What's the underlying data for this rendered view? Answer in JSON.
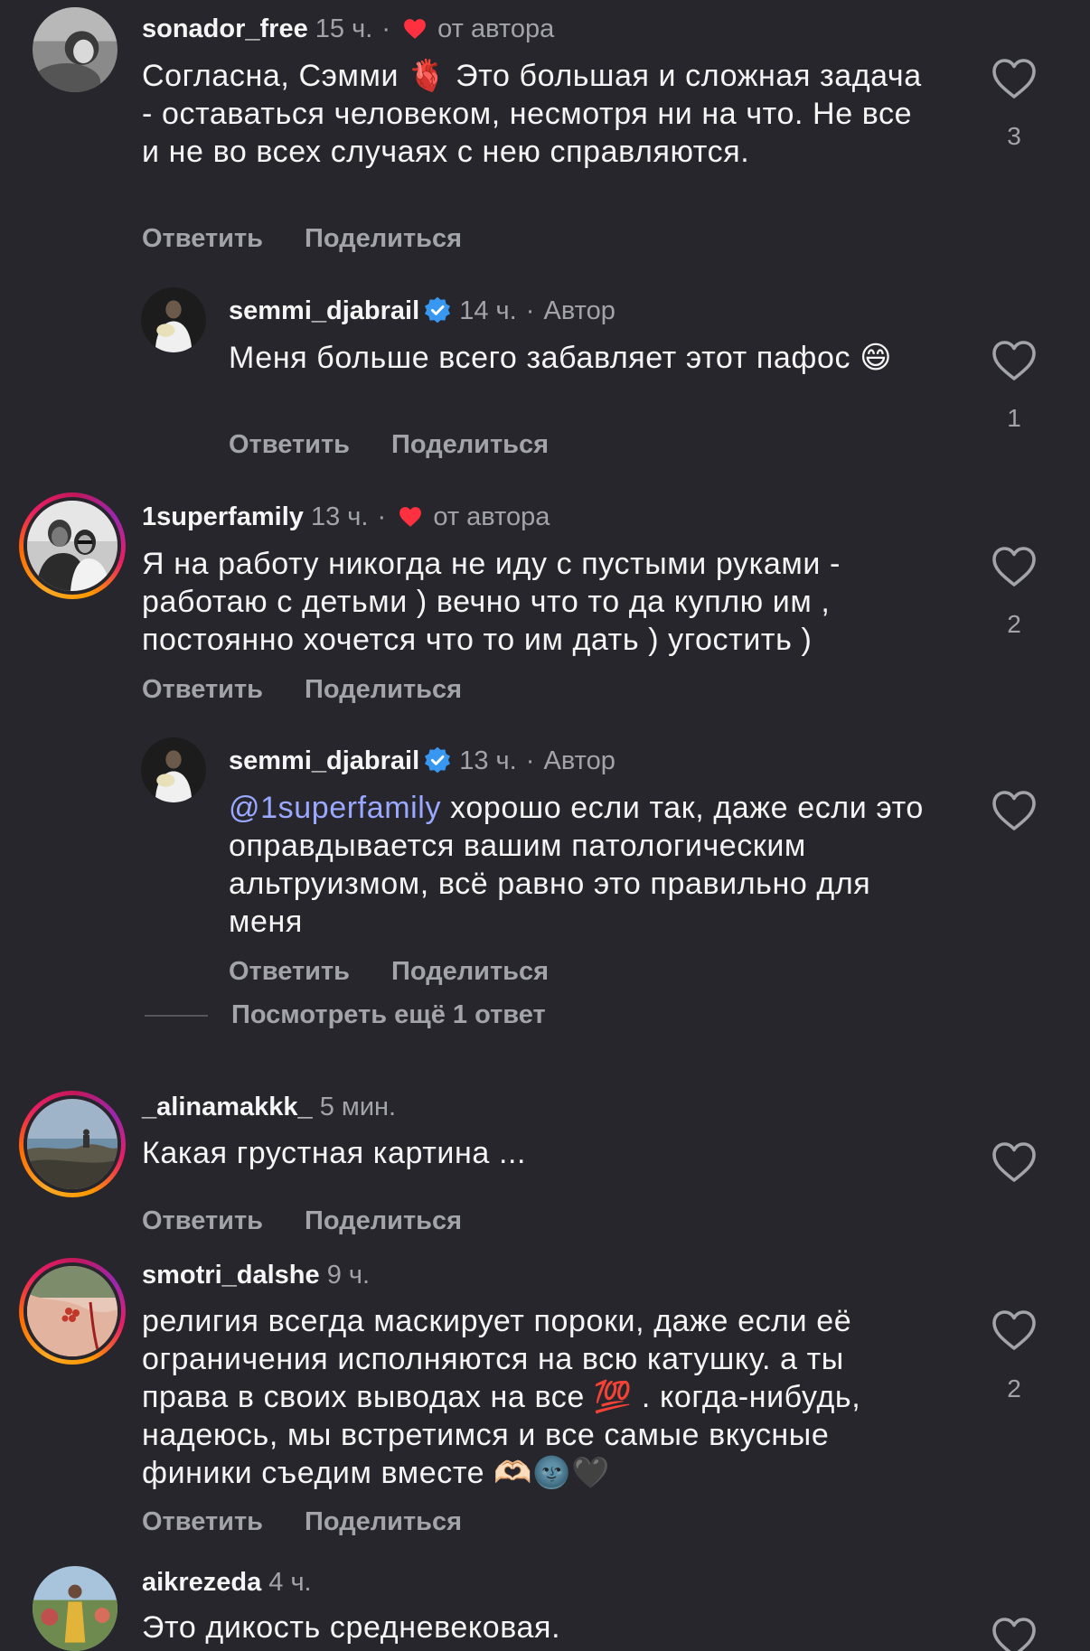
{
  "labels": {
    "reply": "Ответить",
    "share": "Поделиться",
    "author": "Автор",
    "liked_by_author": "от автора",
    "dot": "·"
  },
  "colors": {
    "background": "#26262c",
    "text_primary": "#f5f5f5",
    "text_secondary": "#a3a3aa",
    "mention": "#9aa8ff",
    "heart_red": "#ff3040",
    "verified_blue": "#3897f0"
  },
  "comments": [
    {
      "username": "sonador_free",
      "time": "15 ч.",
      "liked_by_author": true,
      "text": "Согласна, Сэмми 🫀 Это большая и сложная задача - оставаться человеком, несмотря ни на что. Не все и не во всех случаях с нею справляются.",
      "likes": "3"
    },
    {
      "username": "semmi_djabrail",
      "verified": true,
      "time": "14 ч.",
      "is_author": true,
      "text": "Меня больше всего забавляет этот пафос 😄",
      "likes": "1"
    },
    {
      "username": "1superfamily",
      "time": "13 ч.",
      "liked_by_author": true,
      "text": "Я на работу никогда не иду с пустыми руками - работаю с детьми ) вечно что то да куплю им , постоянно хочется что то им дать ) угостить )",
      "likes": "2"
    },
    {
      "username": "semmi_djabrail",
      "verified": true,
      "time": "13 ч.",
      "is_author": true,
      "mention": "@1superfamily",
      "text": " хорошо если так, даже если это оправдывается вашим патологическим альтруизмом, всё равно это правильно для меня",
      "likes": "",
      "more_replies": "Посмотреть ещё 1 ответ"
    },
    {
      "username": "_alinamakkk_",
      "time": "5 мин.",
      "text": "Какая грустная картина ...",
      "likes": ""
    },
    {
      "username": "smotri_dalshe",
      "time": "9 ч.",
      "text": "религия всегда маскирует пороки, даже если её ограничения исполняются на всю катушку. а ты права в своих выводах на все 💯 . когда-нибудь, надеюсь, мы встретимся и все самые вкусные финики съедим вместе 🫶🏻🌚🖤",
      "likes": "2"
    },
    {
      "username": "aikrezeda",
      "time": "4 ч.",
      "text": "Это дикость средневековая.",
      "likes": ""
    }
  ]
}
